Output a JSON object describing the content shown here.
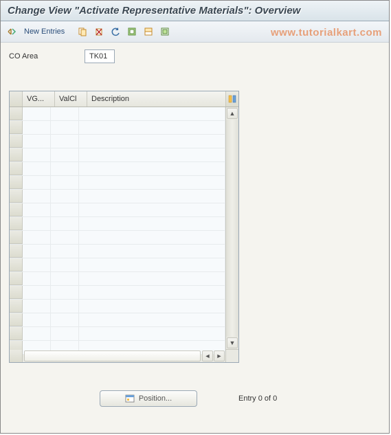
{
  "title": "Change View \"Activate Representative Materials\": Overview",
  "watermark": "www.tutorialkart.com",
  "toolbar": {
    "new_entries_label": "New Entries"
  },
  "fields": {
    "co_area_label": "CO Area",
    "co_area_value": "TK01"
  },
  "grid": {
    "columns": {
      "vg": "VG...",
      "valcl": "ValCl",
      "description": "Description"
    },
    "row_count": 18
  },
  "footer": {
    "position_label": "Position...",
    "entry_label": "Entry 0 of 0"
  }
}
